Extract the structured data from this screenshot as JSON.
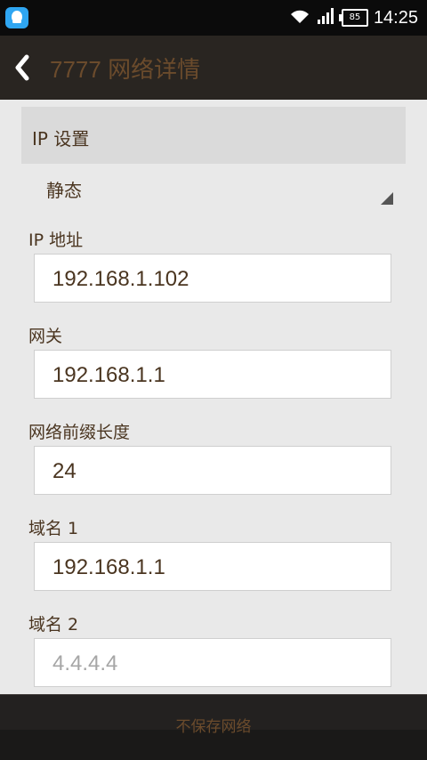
{
  "status_bar": {
    "time": "14:25",
    "battery": "85",
    "icons": [
      "qq-notification-icon",
      "wifi-icon",
      "signal-icon",
      "battery-icon"
    ]
  },
  "action_bar": {
    "title": "7777 网络详情"
  },
  "ip_settings": {
    "header": "IP 设置",
    "mode": "静态"
  },
  "fields": {
    "ip_address": {
      "label": "IP 地址",
      "value": "192.168.1.102"
    },
    "gateway": {
      "label": "网关",
      "value": "192.168.1.1"
    },
    "prefix_length": {
      "label": "网络前缀长度",
      "value": "24"
    },
    "dns1": {
      "label": "域名 1",
      "value": "192.168.1.1"
    },
    "dns2": {
      "label": "域名 2",
      "placeholder": "4.4.4.4"
    }
  },
  "bottom_bar": {
    "button": "不保存网络"
  },
  "colors": {
    "accent": "#6b4b2c",
    "background": "#e9e9e9",
    "action_bar": "#292521",
    "status_bar": "#0b0b0b"
  }
}
